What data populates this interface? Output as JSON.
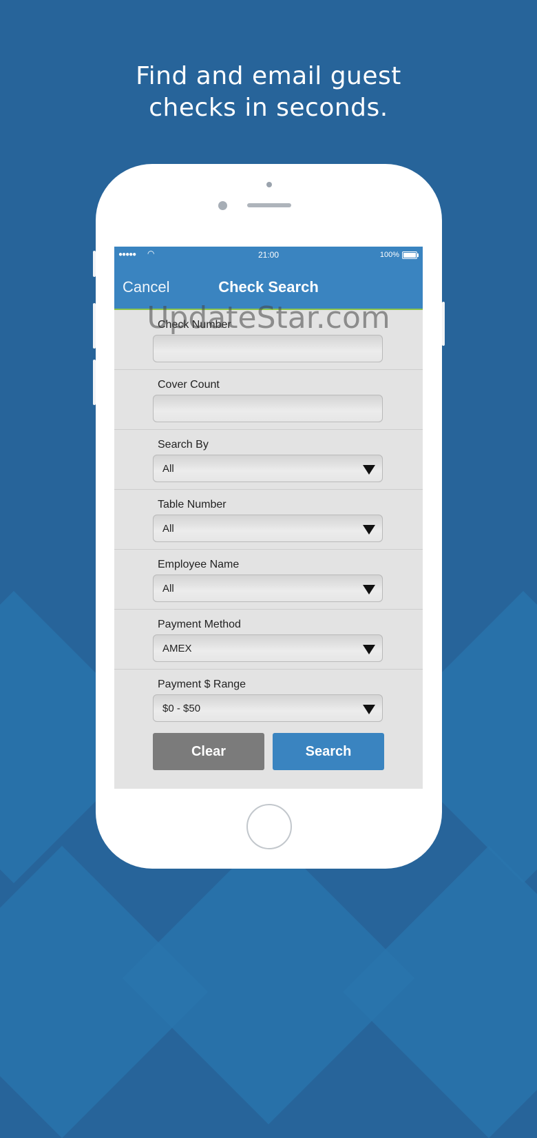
{
  "headline": {
    "line1": "Find and email guest",
    "line2": "checks in seconds."
  },
  "status_bar": {
    "signal": "●●●●●",
    "wifi": "◠",
    "time": "21:00",
    "battery": "100%"
  },
  "nav": {
    "cancel_label": "Cancel",
    "title": "Check Search"
  },
  "fields": [
    {
      "label": "Check Number",
      "value": "",
      "type": "text"
    },
    {
      "label": "Cover Count",
      "value": "",
      "type": "text"
    },
    {
      "label": "Search By",
      "value": "All",
      "type": "select"
    },
    {
      "label": "Table Number",
      "value": "All",
      "type": "select"
    },
    {
      "label": "Employee Name",
      "value": "All",
      "type": "select"
    },
    {
      "label": "Payment Method",
      "value": "AMEX",
      "type": "select"
    },
    {
      "label": "Payment $ Range",
      "value": "$0 - $50",
      "type": "select"
    }
  ],
  "buttons": {
    "clear_label": "Clear",
    "search_label": "Search"
  },
  "watermark": "UpdateStar.com",
  "colors": {
    "background": "#27649a",
    "nav_blue": "#3a84c0",
    "accent_green": "#8bc34a",
    "clear_gray": "#7b7b7b"
  }
}
